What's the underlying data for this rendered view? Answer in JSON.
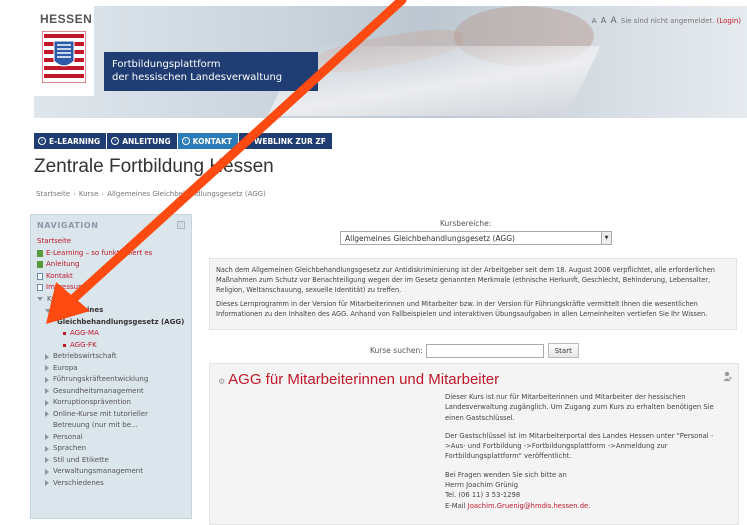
{
  "header": {
    "logo_text": "HESSEN",
    "title_line1": "Fortbildungsplattform",
    "title_line2": "der hessischen Landesverwaltung",
    "font_sizes": [
      "A",
      "A",
      "A"
    ],
    "login_status": "Sie sind nicht angemeldet.",
    "login_link": "(Login)"
  },
  "nav": [
    {
      "label": "E-LEARNING"
    },
    {
      "label": "ANLEITUNG"
    },
    {
      "label": "KONTAKT"
    },
    {
      "label": "WEBLINK ZUR ZF"
    }
  ],
  "page_title": "Zentrale Fortbildung Hessen",
  "breadcrumb": [
    "Startseite",
    "Kurse",
    "Allgemeines Gleichbehandlungsgesetz (AGG)"
  ],
  "sidebar": {
    "heading": "NAVIGATION",
    "items": [
      {
        "label": "Startseite"
      },
      {
        "label": "E-Learning – so funktioniert es"
      },
      {
        "label": "Anleitung"
      },
      {
        "label": "Kontakt"
      },
      {
        "label": "Impressum"
      },
      {
        "label": "Kurse"
      },
      {
        "label": "Allgemeines"
      },
      {
        "label": "Gleichbehandlungsgesetz (AGG)"
      },
      {
        "label": "AGG-MA"
      },
      {
        "label": "AGG-FK"
      },
      {
        "label": "Betriebswirtschaft"
      },
      {
        "label": "Europa"
      },
      {
        "label": "Führungskräfteentwicklung"
      },
      {
        "label": "Gesundheitsmanagement"
      },
      {
        "label": "Korruptionsprävention"
      },
      {
        "label": "Online-Kurse mit tutorieller"
      },
      {
        "label": "Betreuung (nur mit be..."
      },
      {
        "label": "Personal"
      },
      {
        "label": "Sprachen"
      },
      {
        "label": "Stil und Etikette"
      },
      {
        "label": "Verwaltungsmanagement"
      },
      {
        "label": "Verschiedenes"
      }
    ]
  },
  "main": {
    "kursbereiche_label": "Kursbereiche:",
    "kursbereiche_selected": "Allgemeines Gleichbehandlungsgesetz (AGG)",
    "description_1": "Nach dem Allgemeinen Gleichbehandlungsgesetz zur Antidiskriminierung ist der Arbeitgeber seit dem 18. August 2006 verpflichtet, alle erforderlichen Maßnahmen zum Schutz vor Benachteiligung wegen der im Gesetz genannten Merkmale (ethnische Herkunft, Geschlecht, Behinderung, Lebensalter, Religion, Weltanschauung, sexuelle Identität) zu treffen.",
    "description_2": "Dieses Lernprogramm in der Version für Mitarbeiterinnen und Mitarbeiter bzw. in der Version für Führungskräfte vermittelt Ihnen die wesentlichen Informationen zu den Inhalten des AGG. Anhand von Fallbeispielen und interaktiven Übungsaufgaben in allen Lerneinheiten vertiefen Sie Ihr Wissen.",
    "search_label": "Kurse suchen:",
    "search_value": "",
    "search_button": "Start"
  },
  "course": {
    "title": "AGG für Mitarbeiterinnen und Mitarbeiter",
    "p1": "Dieser Kurs ist nur für Mitarbeiterinnen und Mitarbeiter der hessischen Landesverwaltung zugänglich. Um Zugang zum Kurs zu erhalten benötigen Sie einen Gastschlüssel.",
    "p2": "Der Gastschlüssel ist im Mitarbeiterportal des Landes Hessen unter \"Personal ->Aus- und Fortbildung ->Fortbildungsplattform ->Anmeldung zur Fortbildungsplattform\" veröffentlicht.",
    "p3_line1": "Bei Fragen wenden Sie sich bitte an",
    "p3_line2": "Herrn Joachim Grünig",
    "p3_line3": "Tel. (06 11) 3 53-1298",
    "p3_email_label": "E-Mail",
    "p3_email": "Joachim.Gruenig@hmdis.hessen.de."
  },
  "colors": {
    "brand_blue": "#1f3d73",
    "active_blue": "#2a7bb7",
    "link_red": "#c0182a",
    "arrow_orange": "#ff4a12"
  }
}
